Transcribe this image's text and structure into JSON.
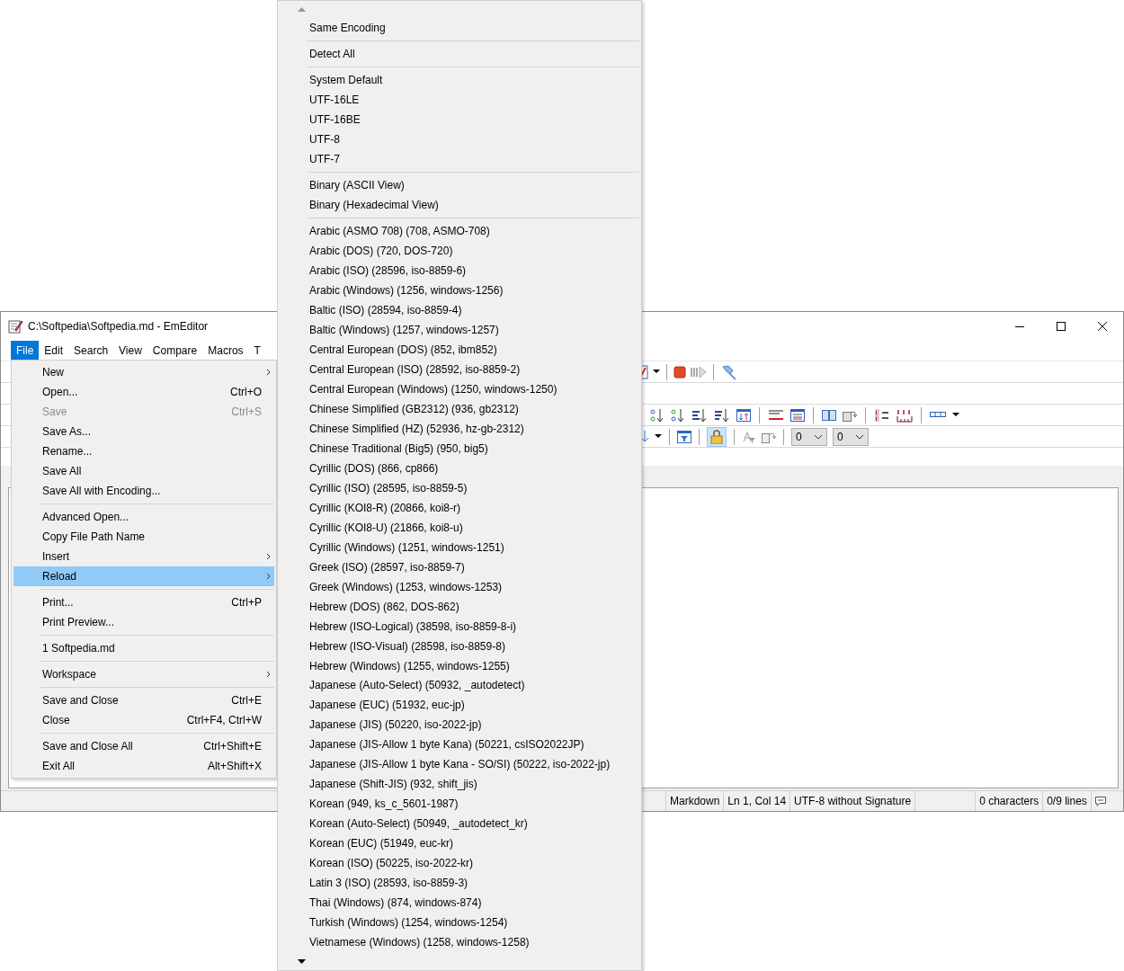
{
  "window": {
    "title": "C:\\Softpedia\\Softpedia.md - EmEditor"
  },
  "menu_bar": [
    {
      "label": "File",
      "selected": true
    },
    {
      "label": "Edit",
      "selected": false
    },
    {
      "label": "Search",
      "selected": false
    },
    {
      "label": "View",
      "selected": false
    },
    {
      "label": "Compare",
      "selected": false
    },
    {
      "label": "Macros",
      "selected": false
    },
    {
      "label": "T",
      "selected": false
    }
  ],
  "toolbar": {
    "lock_selected": true,
    "combos": [
      {
        "value": "0"
      },
      {
        "value": "0"
      }
    ]
  },
  "file_menu": [
    {
      "kind": "item",
      "label": "New",
      "submenu": true,
      "disabled": false,
      "selected": false
    },
    {
      "kind": "item",
      "label": "Open...",
      "shortcut": "Ctrl+O",
      "submenu": false,
      "disabled": false,
      "selected": false
    },
    {
      "kind": "item",
      "label": "Save",
      "shortcut": "Ctrl+S",
      "submenu": false,
      "disabled": true,
      "selected": false
    },
    {
      "kind": "item",
      "label": "Save As...",
      "submenu": false,
      "disabled": false,
      "selected": false
    },
    {
      "kind": "item",
      "label": "Rename...",
      "submenu": false,
      "disabled": false,
      "selected": false
    },
    {
      "kind": "item",
      "label": "Save All",
      "submenu": false,
      "disabled": false,
      "selected": false
    },
    {
      "kind": "item",
      "label": "Save All with Encoding...",
      "submenu": false,
      "disabled": false,
      "selected": false
    },
    {
      "kind": "separator"
    },
    {
      "kind": "item",
      "label": "Advanced Open...",
      "submenu": false,
      "disabled": false,
      "selected": false
    },
    {
      "kind": "item",
      "label": "Copy File Path Name",
      "submenu": false,
      "disabled": false,
      "selected": false
    },
    {
      "kind": "item",
      "label": "Insert",
      "submenu": true,
      "disabled": false,
      "selected": false
    },
    {
      "kind": "item",
      "label": "Reload",
      "submenu": true,
      "disabled": false,
      "selected": true
    },
    {
      "kind": "separator"
    },
    {
      "kind": "item",
      "label": "Print...",
      "shortcut": "Ctrl+P",
      "submenu": false,
      "disabled": false,
      "selected": false
    },
    {
      "kind": "item",
      "label": "Print Preview...",
      "submenu": false,
      "disabled": false,
      "selected": false
    },
    {
      "kind": "separator"
    },
    {
      "kind": "item",
      "label": "1 Softpedia.md",
      "submenu": false,
      "disabled": false,
      "selected": false
    },
    {
      "kind": "separator"
    },
    {
      "kind": "item",
      "label": "Workspace",
      "submenu": true,
      "disabled": false,
      "selected": false
    },
    {
      "kind": "separator"
    },
    {
      "kind": "item",
      "label": "Save and Close",
      "shortcut": "Ctrl+E",
      "submenu": false,
      "disabled": false,
      "selected": false
    },
    {
      "kind": "item",
      "label": "Close",
      "shortcut": "Ctrl+F4, Ctrl+W",
      "submenu": false,
      "disabled": false,
      "selected": false
    },
    {
      "kind": "separator"
    },
    {
      "kind": "item",
      "label": "Save and Close All",
      "shortcut": "Ctrl+Shift+E",
      "submenu": false,
      "disabled": false,
      "selected": false
    },
    {
      "kind": "item",
      "label": "Exit All",
      "shortcut": "Alt+Shift+X",
      "submenu": false,
      "disabled": false,
      "selected": false
    }
  ],
  "encoding_menu": [
    {
      "kind": "item",
      "label": "Same Encoding"
    },
    {
      "kind": "separator"
    },
    {
      "kind": "item",
      "label": "Detect All"
    },
    {
      "kind": "separator"
    },
    {
      "kind": "item",
      "label": "System Default"
    },
    {
      "kind": "item",
      "label": "UTF-16LE"
    },
    {
      "kind": "item",
      "label": "UTF-16BE"
    },
    {
      "kind": "item",
      "label": "UTF-8"
    },
    {
      "kind": "item",
      "label": "UTF-7"
    },
    {
      "kind": "separator"
    },
    {
      "kind": "item",
      "label": "Binary (ASCII View)"
    },
    {
      "kind": "item",
      "label": "Binary (Hexadecimal View)"
    },
    {
      "kind": "separator"
    },
    {
      "kind": "item",
      "label": "Arabic (ASMO 708) (708, ASMO-708)"
    },
    {
      "kind": "item",
      "label": "Arabic (DOS) (720, DOS-720)"
    },
    {
      "kind": "item",
      "label": "Arabic (ISO) (28596, iso-8859-6)"
    },
    {
      "kind": "item",
      "label": "Arabic (Windows) (1256, windows-1256)"
    },
    {
      "kind": "item",
      "label": "Baltic (ISO) (28594, iso-8859-4)"
    },
    {
      "kind": "item",
      "label": "Baltic (Windows) (1257, windows-1257)"
    },
    {
      "kind": "item",
      "label": "Central European (DOS) (852, ibm852)"
    },
    {
      "kind": "item",
      "label": "Central European (ISO) (28592, iso-8859-2)"
    },
    {
      "kind": "item",
      "label": "Central European (Windows) (1250, windows-1250)"
    },
    {
      "kind": "item",
      "label": "Chinese Simplified (GB2312) (936, gb2312)"
    },
    {
      "kind": "item",
      "label": "Chinese Simplified (HZ) (52936, hz-gb-2312)"
    },
    {
      "kind": "item",
      "label": "Chinese Traditional (Big5) (950, big5)"
    },
    {
      "kind": "item",
      "label": "Cyrillic (DOS) (866, cp866)"
    },
    {
      "kind": "item",
      "label": "Cyrillic (ISO) (28595, iso-8859-5)"
    },
    {
      "kind": "item",
      "label": "Cyrillic (KOI8-R) (20866, koi8-r)"
    },
    {
      "kind": "item",
      "label": "Cyrillic (KOI8-U) (21866, koi8-u)"
    },
    {
      "kind": "item",
      "label": "Cyrillic (Windows) (1251, windows-1251)"
    },
    {
      "kind": "item",
      "label": "Greek (ISO) (28597, iso-8859-7)"
    },
    {
      "kind": "item",
      "label": "Greek (Windows) (1253, windows-1253)"
    },
    {
      "kind": "item",
      "label": "Hebrew (DOS) (862, DOS-862)"
    },
    {
      "kind": "item",
      "label": "Hebrew (ISO-Logical) (38598, iso-8859-8-i)"
    },
    {
      "kind": "item",
      "label": "Hebrew (ISO-Visual) (28598, iso-8859-8)"
    },
    {
      "kind": "item",
      "label": "Hebrew (Windows) (1255, windows-1255)"
    },
    {
      "kind": "item",
      "label": "Japanese (Auto-Select) (50932, _autodetect)"
    },
    {
      "kind": "item",
      "label": "Japanese (EUC) (51932, euc-jp)"
    },
    {
      "kind": "item",
      "label": "Japanese (JIS) (50220, iso-2022-jp)"
    },
    {
      "kind": "item",
      "label": "Japanese (JIS-Allow 1 byte Kana) (50221, csISO2022JP)"
    },
    {
      "kind": "item",
      "label": "Japanese (JIS-Allow 1 byte Kana - SO/SI) (50222, iso-2022-jp)"
    },
    {
      "kind": "item",
      "label": "Japanese (Shift-JIS) (932, shift_jis)"
    },
    {
      "kind": "item",
      "label": "Korean (949, ks_c_5601-1987)"
    },
    {
      "kind": "item",
      "label": "Korean (Auto-Select) (50949, _autodetect_kr)"
    },
    {
      "kind": "item",
      "label": "Korean (EUC) (51949, euc-kr)"
    },
    {
      "kind": "item",
      "label": "Korean (ISO) (50225, iso-2022-kr)"
    },
    {
      "kind": "item",
      "label": "Latin 3 (ISO) (28593, iso-8859-3)"
    },
    {
      "kind": "item",
      "label": "Thai (Windows) (874, windows-874)"
    },
    {
      "kind": "item",
      "label": "Turkish (Windows) (1254, windows-1254)"
    },
    {
      "kind": "item",
      "label": "Vietnamese (Windows) (1258, windows-1258)"
    }
  ],
  "status_bar": [
    "Markdown",
    "Ln 1, Col 14",
    "UTF-8 without Signature",
    "0 characters",
    "0/9 lines"
  ]
}
